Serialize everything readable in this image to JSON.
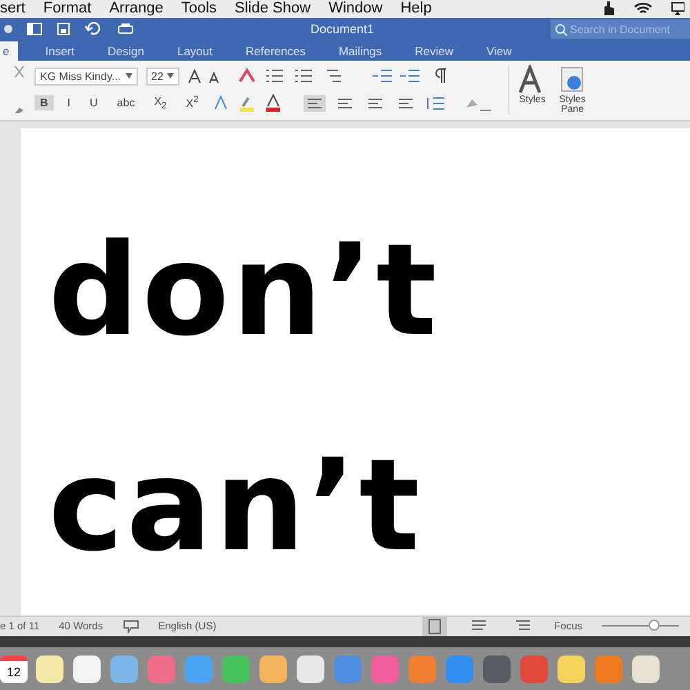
{
  "menu_bar": {
    "items": [
      "sert",
      "Format",
      "Arrange",
      "Tools",
      "Slide Show",
      "Window",
      "Help"
    ]
  },
  "window": {
    "title": "Document1"
  },
  "search": {
    "placeholder": "Search in Document"
  },
  "tabs": [
    {
      "label": "e",
      "selected": true
    },
    {
      "label": "Insert",
      "selected": false
    },
    {
      "label": "Design",
      "selected": false
    },
    {
      "label": "Layout",
      "selected": false
    },
    {
      "label": "References",
      "selected": false
    },
    {
      "label": "Mailings",
      "selected": false
    },
    {
      "label": "Review",
      "selected": false
    },
    {
      "label": "View",
      "selected": false
    }
  ],
  "ribbon": {
    "font": "KG Miss Kindy...",
    "size": "22",
    "format_buttons": [
      {
        "label": "B",
        "selected": true
      },
      {
        "label": "I",
        "selected": false
      },
      {
        "label": "U",
        "selected": false
      },
      {
        "label": "abc",
        "selected": false
      },
      {
        "label": "X$_{2}$",
        "selected": false
      },
      {
        "label": "X$^{2}$",
        "selected": false
      }
    ],
    "align_buttons": [
      {
        "selected": true
      },
      {
        "selected": false
      },
      {
        "selected": false
      },
      {
        "selected": false
      }
    ],
    "styles": "Styles",
    "styles_pane": "Styles Pane"
  },
  "document": {
    "lines": [
      "don’t",
      "can’t"
    ]
  },
  "status_bar": {
    "page": "e 1 of 11",
    "words": "40 Words",
    "language": "English (US)",
    "focus": "Focus",
    "zoom": {
      "level": 0.68
    }
  },
  "dock": {
    "calendar_day": "12"
  }
}
